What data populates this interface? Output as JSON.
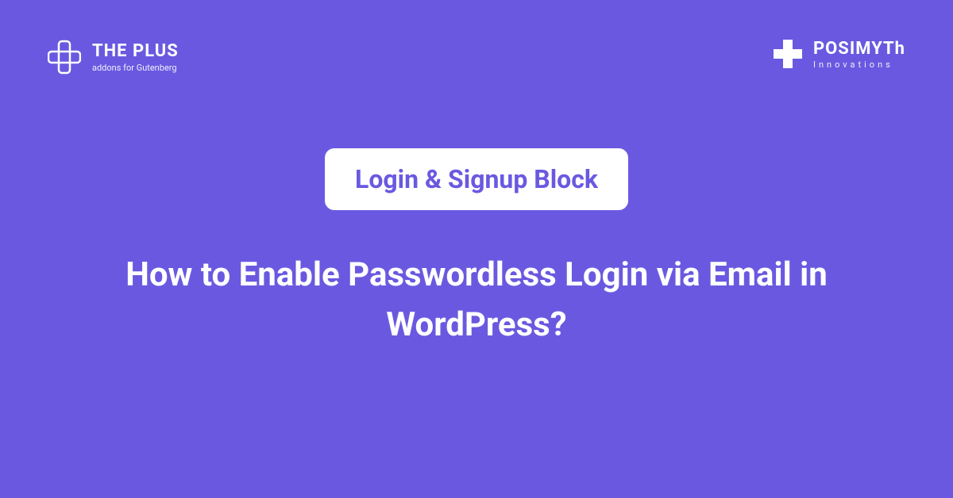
{
  "brand_left": {
    "title": "THE PLUS",
    "subtitle": "addons for Gutenberg"
  },
  "brand_right": {
    "title": "POSIMYTh",
    "subtitle": "Innovations"
  },
  "badge": {
    "label": "Login & Signup Block"
  },
  "headline": "How to Enable Passwordless Login via Email in WordPress?",
  "colors": {
    "background": "#6a59e0",
    "text_light": "#ffffff",
    "badge_bg": "#ffffff",
    "badge_text": "#6a59e0"
  }
}
